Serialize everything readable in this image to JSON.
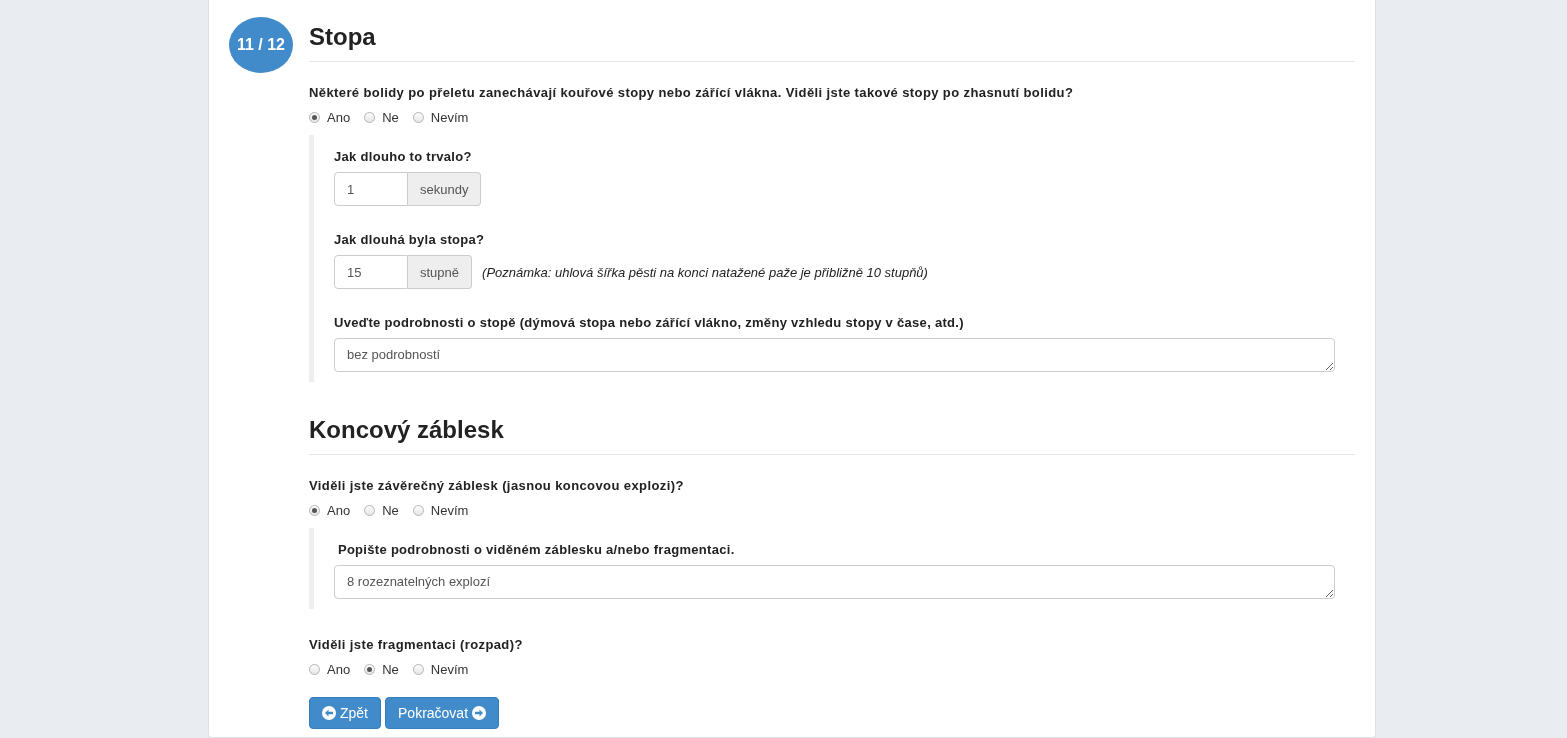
{
  "step": "11 / 12",
  "sections": [
    {
      "title": "Stopa",
      "questions": [
        {
          "label": "Některé bolidy po přeletu zanechávají kouřové stopy nebo zářící vlákna. Viděli jste takové stopy po zhasnutí bolidu?",
          "options": [
            {
              "label": "Ano",
              "selected": true
            },
            {
              "label": "Ne",
              "selected": false
            },
            {
              "label": "Nevím",
              "selected": false
            }
          ],
          "details": [
            {
              "kind": "unit",
              "label": "Jak dlouho to trvalo?",
              "value": "1",
              "unit": "sekundy"
            },
            {
              "kind": "unit",
              "label": "Jak dlouhá byla stopa?",
              "value": "15",
              "unit": "stupně",
              "note": "(Poznámka: uhlová šířka pěsti na konci natažené paže je přibližně 10 stupňů)"
            },
            {
              "kind": "text",
              "label": "Uveďte podrobnosti o stopě (dýmová stopa nebo zářící vlákno, změny vzhledu stopy v čase, atd.)",
              "value": "bez podrobností"
            }
          ]
        }
      ]
    },
    {
      "title": "Koncový záblesk",
      "questions": [
        {
          "label": "Viděli jste závěrečný záblesk (jasnou koncovou explozi)?",
          "options": [
            {
              "label": "Ano",
              "selected": true
            },
            {
              "label": "Ne",
              "selected": false
            },
            {
              "label": "Nevím",
              "selected": false
            }
          ],
          "details": [
            {
              "kind": "text",
              "label": " Popište podrobnosti o viděném záblesku a/nebo fragmentaci.",
              "value": "8 rozeznatelných explozí"
            }
          ]
        },
        {
          "label": "Viděli jste fragmentaci (rozpad)?",
          "options": [
            {
              "label": "Ano",
              "selected": false
            },
            {
              "label": "Ne",
              "selected": true
            },
            {
              "label": "Nevím",
              "selected": false
            }
          ]
        }
      ]
    }
  ],
  "buttons": [
    {
      "kind": "back",
      "label": "Zpět"
    },
    {
      "kind": "next",
      "label": "Pokračovat"
    }
  ]
}
